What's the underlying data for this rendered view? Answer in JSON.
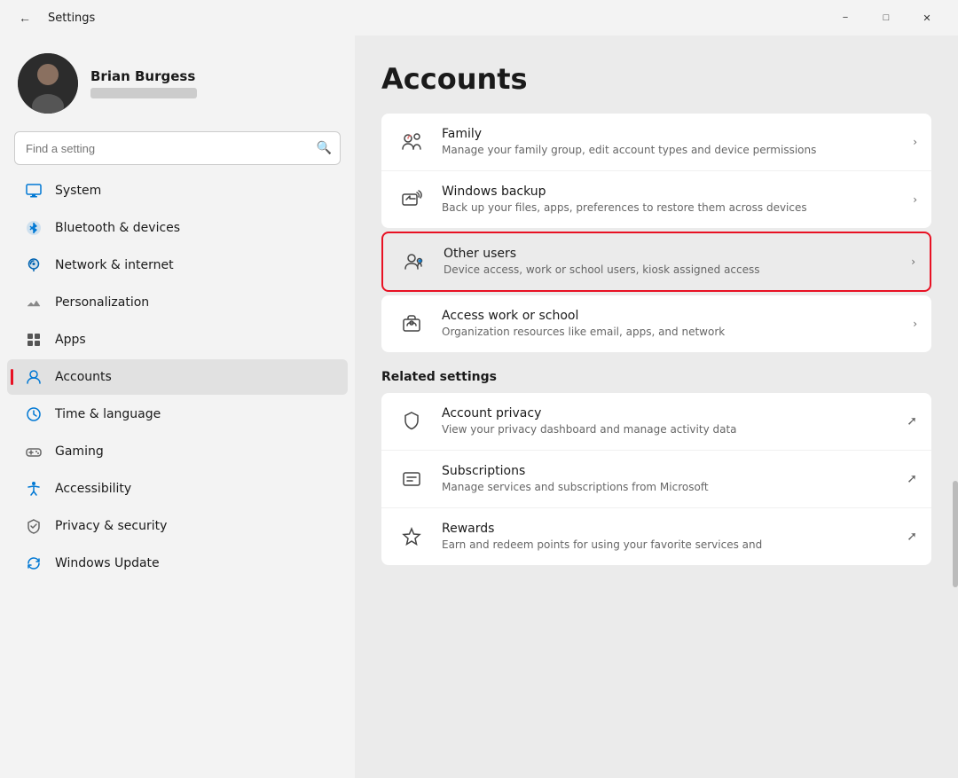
{
  "titlebar": {
    "title": "Settings",
    "minimize_label": "−",
    "maximize_label": "□",
    "close_label": "✕"
  },
  "user": {
    "name": "Brian Burgess"
  },
  "search": {
    "placeholder": "Find a setting"
  },
  "nav": {
    "items": [
      {
        "id": "system",
        "label": "System",
        "icon": "system"
      },
      {
        "id": "bluetooth",
        "label": "Bluetooth & devices",
        "icon": "bluetooth"
      },
      {
        "id": "network",
        "label": "Network & internet",
        "icon": "network"
      },
      {
        "id": "personalization",
        "label": "Personalization",
        "icon": "personalization"
      },
      {
        "id": "apps",
        "label": "Apps",
        "icon": "apps"
      },
      {
        "id": "accounts",
        "label": "Accounts",
        "icon": "accounts",
        "active": true
      },
      {
        "id": "time",
        "label": "Time & language",
        "icon": "time"
      },
      {
        "id": "gaming",
        "label": "Gaming",
        "icon": "gaming"
      },
      {
        "id": "accessibility",
        "label": "Accessibility",
        "icon": "accessibility"
      },
      {
        "id": "privacy",
        "label": "Privacy & security",
        "icon": "privacy"
      },
      {
        "id": "update",
        "label": "Windows Update",
        "icon": "update"
      }
    ]
  },
  "main": {
    "title": "Accounts",
    "cards": [
      {
        "items": [
          {
            "id": "family",
            "title": "Family",
            "subtitle": "Manage your family group, edit account types and device permissions",
            "icon": "family"
          },
          {
            "id": "windows-backup",
            "title": "Windows backup",
            "subtitle": "Back up your files, apps, preferences to restore them across devices",
            "icon": "backup"
          }
        ]
      },
      {
        "highlighted": true,
        "items": [
          {
            "id": "other-users",
            "title": "Other users",
            "subtitle": "Device access, work or school users, kiosk assigned access",
            "icon": "other-users",
            "highlighted": true
          }
        ]
      },
      {
        "items": [
          {
            "id": "access-work",
            "title": "Access work or school",
            "subtitle": "Organization resources like email, apps, and network",
            "icon": "work"
          }
        ]
      }
    ],
    "related_settings_title": "Related settings",
    "related": [
      {
        "id": "account-privacy",
        "title": "Account privacy",
        "subtitle": "View your privacy dashboard and manage activity data",
        "icon": "shield",
        "external": true
      },
      {
        "id": "subscriptions",
        "title": "Subscriptions",
        "subtitle": "Manage services and subscriptions from Microsoft",
        "icon": "subscriptions",
        "external": true
      },
      {
        "id": "rewards",
        "title": "Rewards",
        "subtitle": "Earn and redeem points for using your favorite services and",
        "icon": "rewards",
        "external": true
      }
    ]
  }
}
